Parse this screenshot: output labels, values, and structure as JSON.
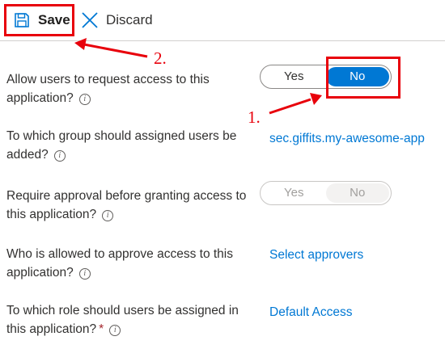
{
  "toolbar": {
    "save_label": "Save",
    "discard_label": "Discard"
  },
  "callouts": {
    "step1": "1.",
    "step2": "2."
  },
  "settings": [
    {
      "label": "Allow users to request access to this application?",
      "control": "toggle",
      "options": [
        "Yes",
        "No"
      ],
      "selected": "No",
      "enabled": true
    },
    {
      "label": "To which group should assigned users be added?",
      "control": "link",
      "value": "sec.giffits.my-awesome-app"
    },
    {
      "label": "Require approval before granting access to this application?",
      "control": "toggle",
      "options": [
        "Yes",
        "No"
      ],
      "selected": "No",
      "enabled": false
    },
    {
      "label": "Who is allowed to approve access to this application?",
      "control": "link",
      "value": "Select approvers"
    },
    {
      "label": "To which role should users be assigned in this application?",
      "control": "link",
      "value": "Default Access",
      "required_mark": "*"
    }
  ],
  "icons": {
    "save": "save-icon",
    "discard": "close-icon",
    "info": "info-icon"
  },
  "colors": {
    "accent": "#0078d4",
    "annotation": "#e8000b",
    "required": "#a4262c"
  }
}
